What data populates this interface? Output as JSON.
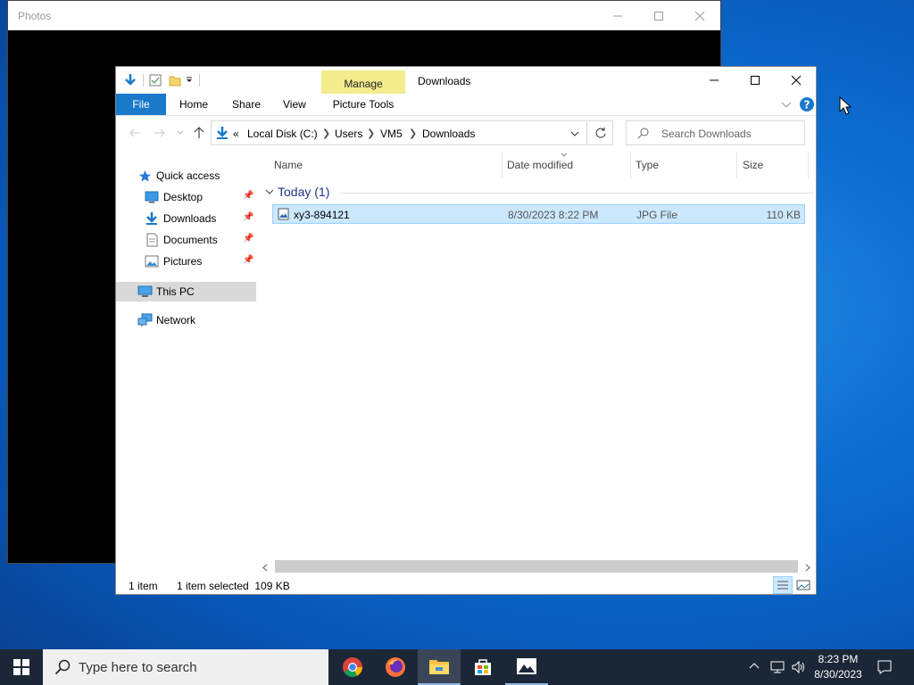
{
  "photos": {
    "title": "Photos"
  },
  "explorer": {
    "window_title": "Downloads",
    "contextual_group": "Manage",
    "ribbon_tabs": {
      "file": "File",
      "home": "Home",
      "share": "Share",
      "view": "View",
      "picture_tools": "Picture Tools"
    },
    "breadcrumb": {
      "overflow": "«",
      "items": [
        "Local Disk (C:)",
        "Users",
        "VM5",
        "Downloads"
      ]
    },
    "search_placeholder": "Search Downloads",
    "nav": {
      "quick_access": "Quick access",
      "desktop": "Desktop",
      "downloads": "Downloads",
      "documents": "Documents",
      "pictures": "Pictures",
      "this_pc": "This PC",
      "network": "Network"
    },
    "columns": {
      "name": "Name",
      "date": "Date modified",
      "type": "Type",
      "size": "Size"
    },
    "group_header": "Today (1)",
    "file": {
      "name": "xy3-894121",
      "date": "8/30/2023 8:22 PM",
      "type": "JPG File",
      "size": "110 KB"
    },
    "status": {
      "count": "1 item",
      "selected": "1 item selected  109 KB"
    }
  },
  "taskbar": {
    "search_placeholder": "Type here to search",
    "time": "8:23 PM",
    "date": "8/30/2023"
  }
}
